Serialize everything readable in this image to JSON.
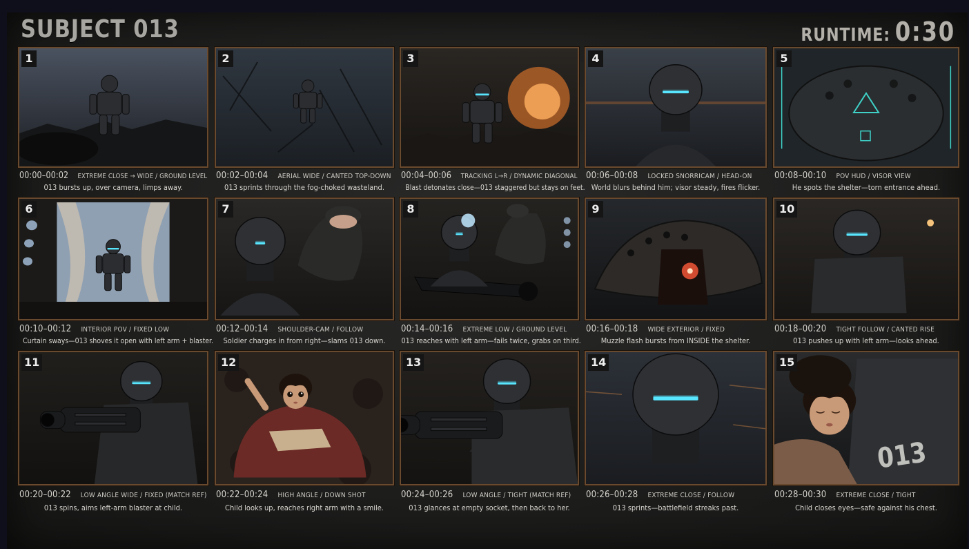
{
  "title": "SUBJECT 013",
  "runtime": {
    "label": "RUNTIME:",
    "value": "0:30"
  },
  "panels": [
    {
      "number": "1",
      "time": "00:00–00:02",
      "shot": "EXTREME CLOSE → WIDE / GROUND LEVEL",
      "description": "013 bursts up, over camera, limps away."
    },
    {
      "number": "2",
      "time": "00:02–00:04",
      "shot": "AERIAL WIDE / CANTED TOP-DOWN",
      "description": "013 sprints through the fog-choked wasteland."
    },
    {
      "number": "3",
      "time": "00:04–00:06",
      "shot": "TRACKING L→R / DYNAMIC DIAGONAL",
      "description": "Blast detonates close—013 staggered but stays on feet."
    },
    {
      "number": "4",
      "time": "00:06–00:08",
      "shot": "LOCKED SNORRICAM / HEAD-ON",
      "description": "World blurs behind him; visor steady, fires flicker."
    },
    {
      "number": "5",
      "time": "00:08–00:10",
      "shot": "POV HUD / VISOR VIEW",
      "description": "He spots the shelter—torn entrance ahead."
    },
    {
      "number": "6",
      "time": "00:10–00:12",
      "shot": "INTERIOR POV / FIXED LOW",
      "description": "Curtain sways—013 shoves it open with left arm + blaster."
    },
    {
      "number": "7",
      "time": "00:12–00:14",
      "shot": "SHOULDER-CAM / FOLLOW",
      "description": "Soldier charges in from right—slams 013 down."
    },
    {
      "number": "8",
      "time": "00:14–00:16",
      "shot": "EXTREME LOW / GROUND LEVEL",
      "description": "013 reaches with left arm—fails twice, grabs on third."
    },
    {
      "number": "9",
      "time": "00:16–00:18",
      "shot": "WIDE EXTERIOR / FIXED",
      "description": "Muzzle flash bursts from INSIDE the shelter."
    },
    {
      "number": "10",
      "time": "00:18–00:20",
      "shot": "TIGHT FOLLOW / CANTED RISE",
      "description": "013 pushes up with left arm—looks ahead."
    },
    {
      "number": "11",
      "time": "00:20–00:22",
      "shot": "LOW ANGLE WIDE / FIXED (MATCH REF)",
      "description": "013 spins, aims left-arm blaster at child."
    },
    {
      "number": "12",
      "time": "00:22–00:24",
      "shot": "HIGH ANGLE / DOWN SHOT",
      "description": "Child looks up, reaches right arm with a smile."
    },
    {
      "number": "13",
      "time": "00:24–00:26",
      "shot": "LOW ANGLE / TIGHT (MATCH REF)",
      "description": "013 glances at empty socket, then back to her."
    },
    {
      "number": "14",
      "time": "00:26–00:28",
      "shot": "EXTREME CLOSE / FOLLOW",
      "description": "013 sprints—battlefield streaks past."
    },
    {
      "number": "15",
      "time": "00:28–00:30",
      "shot": "EXTREME CLOSE / TIGHT",
      "description": "Child closes eyes—safe against his chest."
    }
  ],
  "overlays": {
    "chest_marking": "013"
  },
  "colors": {
    "frame": "#6a4a2e",
    "visor": "#58e6ff",
    "hud": "#3fd2c8",
    "flash": "#ff5a3a"
  }
}
